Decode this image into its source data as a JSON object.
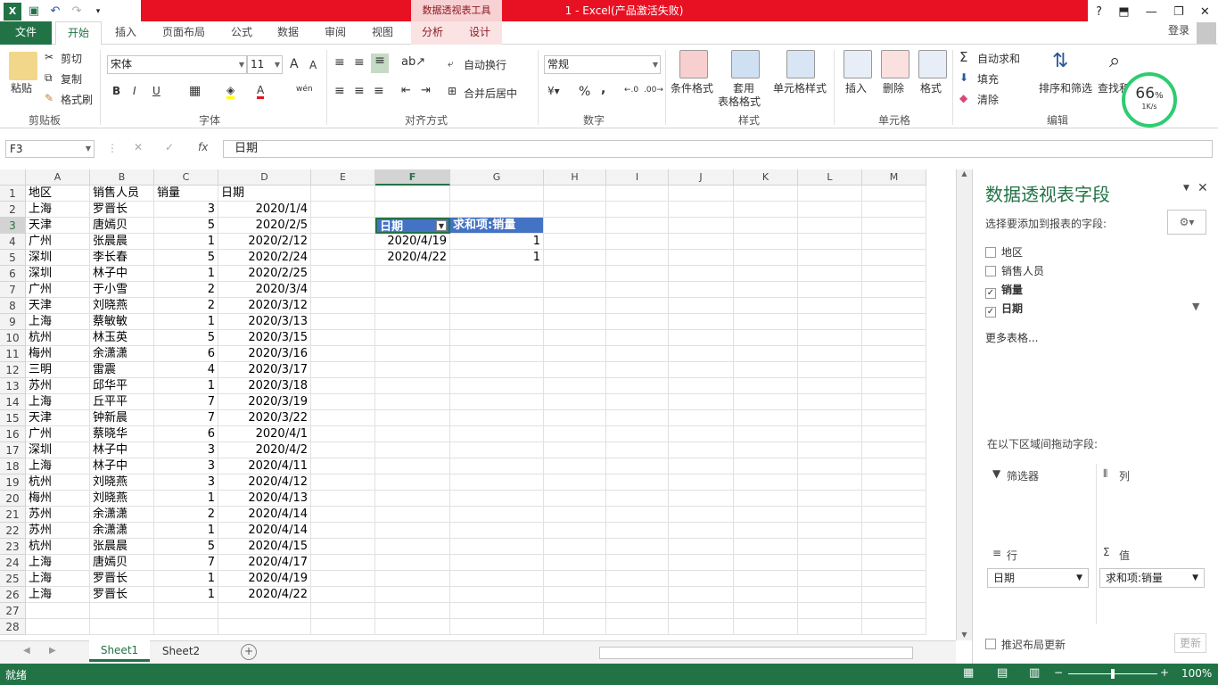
{
  "titlebar": {
    "context_tools": "数据透视表工具",
    "window_title": "1 - Excel(产品激活失败)",
    "help": "?",
    "restore_ribbon": "⬒",
    "minimize": "—",
    "maximize": "❐",
    "close": "✕"
  },
  "tabs": {
    "file": "文件",
    "home": "开始",
    "insert": "插入",
    "page_layout": "页面布局",
    "formulas": "公式",
    "data": "数据",
    "review": "审阅",
    "view": "视图",
    "analyze": "分析",
    "design": "设计",
    "signin": "登录"
  },
  "ribbon": {
    "clipboard": {
      "paste": "粘贴",
      "cut": "剪切",
      "copy": "复制",
      "format_painter": "格式刷",
      "label": "剪贴板"
    },
    "font": {
      "name": "宋体",
      "size": "11",
      "grow": "A",
      "shrink": "A",
      "bold": "B",
      "italic": "I",
      "underline": "U",
      "phonetic": "wén",
      "label": "字体"
    },
    "alignment": {
      "wrap": "自动换行",
      "merge": "合并后居中",
      "label": "对齐方式"
    },
    "number": {
      "format": "常规",
      "percent": "%",
      "comma": ",",
      "label": "数字"
    },
    "styles": {
      "conditional": "条件格式",
      "table": "套用",
      "table2": "表格格式",
      "cell_styles": "单元格样式",
      "label": "样式"
    },
    "cells": {
      "insert": "插入",
      "delete": "删除",
      "format": "格式",
      "label": "单元格"
    },
    "editing": {
      "autosum": "自动求和",
      "fill": "填充",
      "clear": "清除",
      "sort": "排序和筛选",
      "find": "查找和",
      "label": "编辑"
    },
    "speed": {
      "percent": "66",
      "unit": "%",
      "rate": "1K/s"
    }
  },
  "formula_bar": {
    "namebox": "F3",
    "fx": "fx",
    "value": "日期"
  },
  "columns": [
    "A",
    "B",
    "C",
    "D",
    "E",
    "F",
    "G",
    "H",
    "I",
    "J",
    "K",
    "L",
    "M"
  ],
  "rows": [
    [
      "地区",
      "销售人员",
      "销量",
      "日期"
    ],
    [
      "上海",
      "罗晋长",
      "3",
      "2020/1/4"
    ],
    [
      "天津",
      "唐嫣贝",
      "5",
      "2020/2/5"
    ],
    [
      "广州",
      "张晨晨",
      "1",
      "2020/2/12"
    ],
    [
      "深圳",
      "李长春",
      "5",
      "2020/2/24"
    ],
    [
      "深圳",
      "林子中",
      "1",
      "2020/2/25"
    ],
    [
      "广州",
      "于小雪",
      "2",
      "2020/3/4"
    ],
    [
      "天津",
      "刘晓燕",
      "2",
      "2020/3/12"
    ],
    [
      "上海",
      "蔡敏敏",
      "1",
      "2020/3/13"
    ],
    [
      "杭州",
      "林玉英",
      "5",
      "2020/3/15"
    ],
    [
      "梅州",
      "余潇潇",
      "6",
      "2020/3/16"
    ],
    [
      "三明",
      "雷震",
      "4",
      "2020/3/17"
    ],
    [
      "苏州",
      "邱华平",
      "1",
      "2020/3/18"
    ],
    [
      "上海",
      "丘平平",
      "7",
      "2020/3/19"
    ],
    [
      "天津",
      "钟新晨",
      "7",
      "2020/3/22"
    ],
    [
      "广州",
      "蔡晓华",
      "6",
      "2020/4/1"
    ],
    [
      "深圳",
      "林子中",
      "3",
      "2020/4/2"
    ],
    [
      "上海",
      "林子中",
      "3",
      "2020/4/11"
    ],
    [
      "杭州",
      "刘晓燕",
      "3",
      "2020/4/12"
    ],
    [
      "梅州",
      "刘晓燕",
      "1",
      "2020/4/13"
    ],
    [
      "苏州",
      "余潇潇",
      "2",
      "2020/4/14"
    ],
    [
      "苏州",
      "余潇潇",
      "1",
      "2020/4/14"
    ],
    [
      "杭州",
      "张晨晨",
      "5",
      "2020/4/15"
    ],
    [
      "上海",
      "唐嫣贝",
      "7",
      "2020/4/17"
    ],
    [
      "上海",
      "罗晋长",
      "1",
      "2020/4/19"
    ],
    [
      "上海",
      "罗晋长",
      "1",
      "2020/4/22"
    ],
    [
      "",
      "",
      "",
      ""
    ],
    [
      "",
      "",
      "",
      ""
    ]
  ],
  "pivot": {
    "hdr_date": "日期",
    "hdr_sum": "求和项:销量",
    "rows": [
      [
        "2020/4/19",
        "1"
      ],
      [
        "2020/4/22",
        "1"
      ]
    ]
  },
  "sheets": {
    "s1": "Sheet1",
    "s2": "Sheet2",
    "add": "+"
  },
  "status": {
    "ready": "就绪",
    "zoom": "100%"
  },
  "pane": {
    "title": "数据透视表字段",
    "subtitle": "选择要添加到报表的字段:",
    "fields": [
      {
        "label": "地区",
        "checked": false
      },
      {
        "label": "销售人员",
        "checked": false
      },
      {
        "label": "销量",
        "checked": true
      },
      {
        "label": "日期",
        "checked": true
      }
    ],
    "more": "更多表格...",
    "drag_hint": "在以下区域间拖动字段:",
    "filters": "筛选器",
    "columns": "列",
    "rows": "行",
    "values": "值",
    "row_field": "日期",
    "value_field": "求和项:销量",
    "defer": "推迟布局更新",
    "update": "更新"
  },
  "colors": {
    "accent": "#217346",
    "title_red": "#e81123",
    "pivot_header": "#4472c4"
  }
}
